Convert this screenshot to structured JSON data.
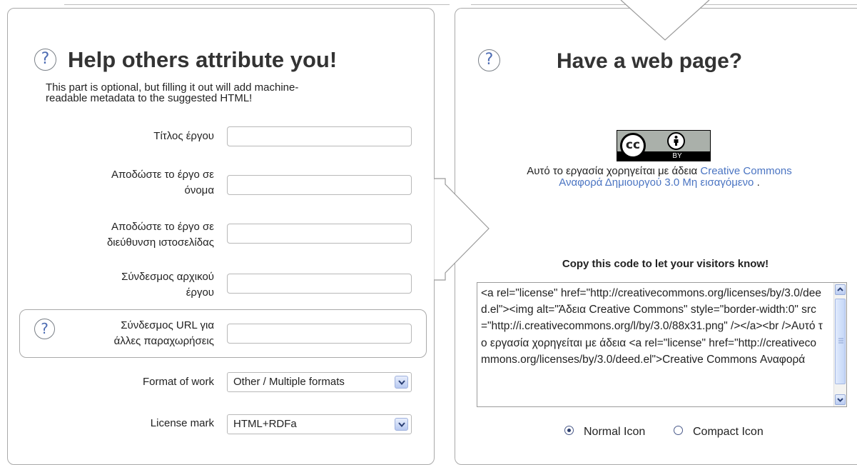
{
  "attribution_panel": {
    "title": "Help others attribute you!",
    "help_glyph": "?",
    "description_line1": "This part is optional, but filling it out will add machine-",
    "description_line2": "readable metadata to the suggested HTML!",
    "fields": [
      {
        "label_line1": "Τίτλος έργου",
        "label_line2": "",
        "value": ""
      },
      {
        "label_line1": "Αποδώστε το έργο σε",
        "label_line2": "όνομα",
        "value": ""
      },
      {
        "label_line1": "Αποδώστε το έργο σε",
        "label_line2": "διεύθυνση ιστοσελίδας",
        "value": ""
      },
      {
        "label_line1": "Σύνδεσμος αρχικού",
        "label_line2": "έργου",
        "value": ""
      },
      {
        "label_line1": "Σύνδεσμος URL για",
        "label_line2": "άλλες παραχωρήσεις",
        "value": ""
      }
    ],
    "format_label": "Format of work",
    "format_value": "Other / Multiple formats",
    "license_mark_label": "License mark",
    "license_mark_value": "HTML+RDFa"
  },
  "web_panel": {
    "title": "Have a web page?",
    "help_glyph": "?",
    "badge": {
      "cc_text": "cc",
      "by_text": "BY"
    },
    "license_prefix": "Αυτό το εργασία χορηγείται με άδεια",
    "license_link_line1": "Creative Commons",
    "license_link_line2": "Αναφορά Δημιουργού 3.0 Μη εισαγόμενο",
    "license_suffix": ".",
    "copy_heading": "Copy this code to let your visitors know!",
    "code": "<a rel=\"license\" href=\"http://creativecommons.org/licenses/by/3.0/deed.el\"><img alt=\"Άδεια Creative Commons\" style=\"border-width:0\" src=\"http://i.creativecommons.org/l/by/3.0/88x31.png\" /></a><br />Αυτό το εργασία χορηγείται με άδεια <a rel=\"license\" href=\"http://creativecommons.org/licenses/by/3.0/deed.el\">Creative Commons Αναφορά",
    "icon_options": [
      {
        "label": "Normal Icon",
        "selected": true
      },
      {
        "label": "Compact Icon",
        "selected": false
      }
    ]
  }
}
